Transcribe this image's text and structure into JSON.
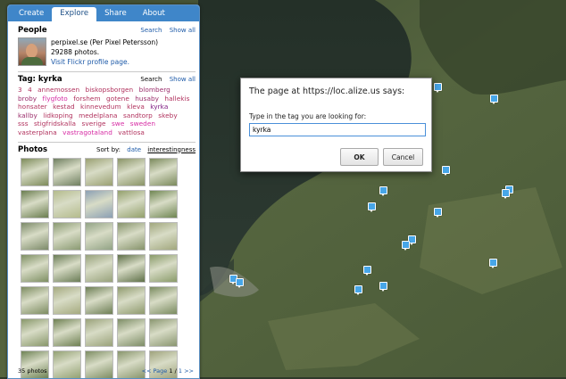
{
  "tabs": [
    "Create",
    "Explore",
    "Share",
    "About"
  ],
  "people": {
    "title": "People",
    "search": "Search",
    "show_all": "Show all",
    "name": "perpixel.se (Per Pixel Petersson)",
    "photo_count": "29288 photos.",
    "profile_link": "Visit Flickr profile page."
  },
  "tag": {
    "title": "Tag: kyrka",
    "search": "Search",
    "show_all": "Show all",
    "cloud": [
      {
        "text": "3",
        "w": "small"
      },
      {
        "text": "4",
        "w": "small"
      },
      {
        "text": "annemossen",
        "w": "small"
      },
      {
        "text": "biskopsborgen",
        "w": "small"
      },
      {
        "text": "blomberg",
        "w": "mid"
      },
      {
        "text": "broby",
        "w": "mid"
      },
      {
        "text": "flygfoto",
        "w": "hot"
      },
      {
        "text": "forshem",
        "w": "small"
      },
      {
        "text": "gotene",
        "w": "small"
      },
      {
        "text": "husaby",
        "w": "mid"
      },
      {
        "text": "hallekis",
        "w": "small"
      },
      {
        "text": "honsater",
        "w": "small"
      },
      {
        "text": "kestad",
        "w": "small"
      },
      {
        "text": "kinnevedum",
        "w": "small"
      },
      {
        "text": "kleva",
        "w": "small"
      },
      {
        "text": "kyrka",
        "w": "big"
      },
      {
        "text": "kallby",
        "w": "mid"
      },
      {
        "text": "lidkoping",
        "w": "small"
      },
      {
        "text": "medelplana",
        "w": "small"
      },
      {
        "text": "sandtorp",
        "w": "small"
      },
      {
        "text": "skeby",
        "w": "small"
      },
      {
        "text": "sss",
        "w": "small"
      },
      {
        "text": "stigfridskalla",
        "w": "small"
      },
      {
        "text": "sverige",
        "w": "small"
      },
      {
        "text": "swe",
        "w": "hot"
      },
      {
        "text": "sweden",
        "w": "hot"
      },
      {
        "text": "vasterplana",
        "w": "small"
      },
      {
        "text": "vastragotaland",
        "w": "hot"
      },
      {
        "text": "vattlosa",
        "w": "small"
      }
    ]
  },
  "photos": {
    "title": "Photos",
    "sort_label": "Sort by:",
    "sort_date": "date",
    "sort_interestingness": "interestingness",
    "count": "35 photos",
    "pager_prev": "<< Page",
    "page_current": "1",
    "page_sep": "/",
    "page_total": "1",
    "pager_next": ">>",
    "thumb_colors": [
      "#7d8b5a",
      "#6f7f60",
      "#9aa072",
      "#8a9467",
      "#7b8a5c",
      "#6a7d4f",
      "#b4bb8c",
      "#8ca0b4",
      "#93a06c",
      "#6f8652",
      "#7c8a69",
      "#8a9a72",
      "#92a385",
      "#86936b",
      "#a1a77d",
      "#7e8f63",
      "#6b7d57",
      "#98a27c",
      "#5f7049",
      "#8a9b6a",
      "#7d8c61",
      "#a5aa7f",
      "#6d7e55",
      "#8f9a6e",
      "#7a8b60",
      "#88976a",
      "#6e8052",
      "#9aa27a",
      "#7d8d66",
      "#8a9670",
      "#6f8356",
      "#93a173",
      "#7d8d63",
      "#88956c",
      "#a0a47d"
    ]
  },
  "dialog": {
    "title": "The page at https://loc.alize.us says:",
    "message": "Type in the tag you are looking for:",
    "input_value": "kyrka",
    "ok": "OK",
    "cancel": "Cancel"
  },
  "colors": {
    "tab_bar": "#3f86c9",
    "link": "#1d5aa8",
    "marker": "#47a6e8",
    "lake": "#2c3a36"
  }
}
